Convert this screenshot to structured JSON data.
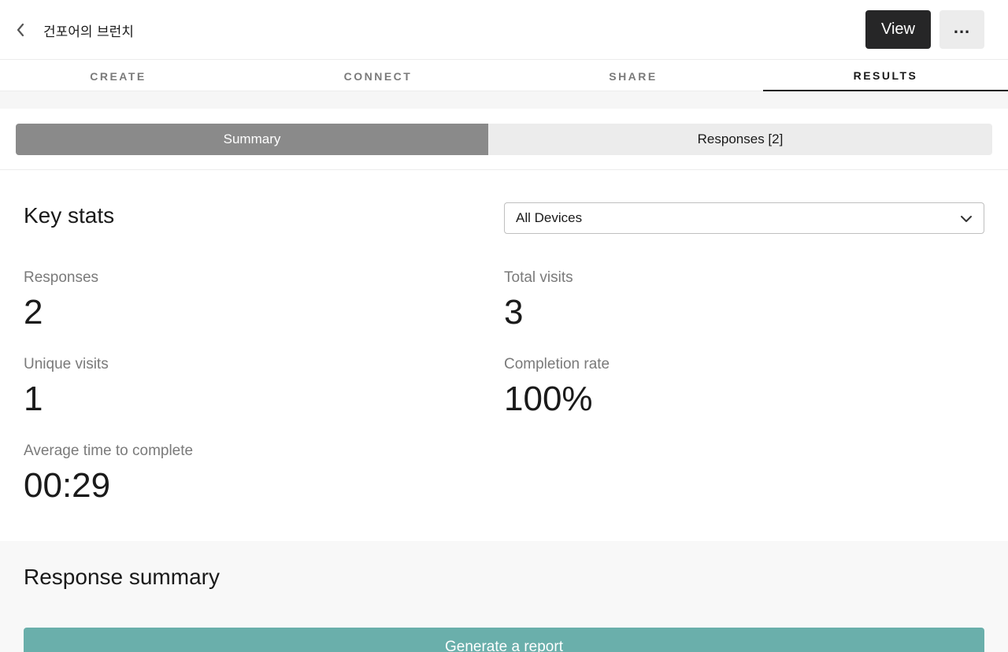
{
  "header": {
    "form_title": "건포어의 브런치",
    "view_label": "View",
    "more_label": "..."
  },
  "nav": {
    "tabs": [
      {
        "label": "CREATE"
      },
      {
        "label": "CONNECT"
      },
      {
        "label": "SHARE"
      },
      {
        "label": "RESULTS"
      }
    ],
    "active": "RESULTS"
  },
  "segments": {
    "summary_label": "Summary",
    "responses_label": "Responses [2]"
  },
  "key_stats": {
    "title": "Key stats",
    "device_filter": "All Devices",
    "responses": {
      "label": "Responses",
      "value": "2"
    },
    "total_visits": {
      "label": "Total visits",
      "value": "3"
    },
    "unique_visits": {
      "label": "Unique visits",
      "value": "1"
    },
    "completion_rate": {
      "label": "Completion rate",
      "value": "100%"
    },
    "avg_time": {
      "label": "Average time to complete",
      "value": "00:29"
    }
  },
  "response_summary": {
    "title": "Response summary",
    "generate_label": "Generate a report"
  },
  "colors": {
    "view_button": "#262627",
    "summary_segment": "#8a8a8a",
    "report_button": "#6aafab"
  }
}
